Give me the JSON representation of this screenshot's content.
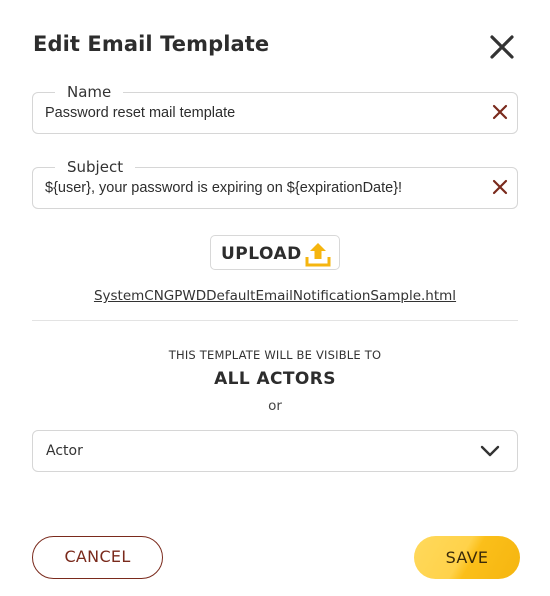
{
  "dialog": {
    "title": "Edit Email Template"
  },
  "fields": {
    "name": {
      "legend": "Name",
      "value": "Password reset mail template"
    },
    "subject": {
      "legend": "Subject",
      "value": "${user}, your password is expiring on ${expirationDate}!"
    }
  },
  "upload": {
    "label": "UPLOAD",
    "file_name": "SystemCNGPWDDefaultEmailNotificationSample.html"
  },
  "visibility": {
    "caption": "THIS TEMPLATE WILL BE VISIBLE TO",
    "audience": "ALL ACTORS",
    "or_text": "or",
    "select_value": "Actor"
  },
  "actions": {
    "cancel_label": "CANCEL",
    "save_label": "SAVE"
  },
  "colors": {
    "clear_icon": "#7a2a1c",
    "upload_icon": "#f5b50f",
    "cancel": "#7a2a1c",
    "save": "#ffd24a"
  },
  "icons": {
    "close": "close-icon",
    "clear": "clear-icon",
    "upload": "upload-arrow-icon",
    "dropdown": "chevron-down-icon"
  }
}
